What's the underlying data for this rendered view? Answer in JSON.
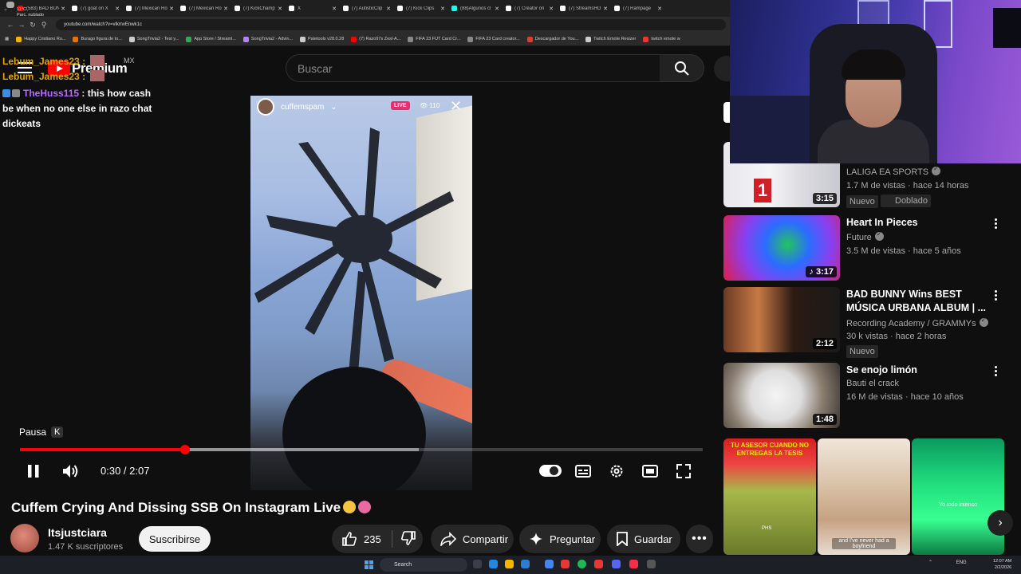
{
  "browser": {
    "tabs": [
      {
        "label": "(583) BAD BUNNY",
        "color": "#ff0000"
      },
      {
        "label": "(7) goat on X",
        "color": "#ffffff"
      },
      {
        "label": "(7) Mexican Ro",
        "color": "#ffffff"
      },
      {
        "label": "(7) Mexican Ro",
        "color": "#ffffff"
      },
      {
        "label": "(7) KickChamp",
        "color": "#ffffff"
      },
      {
        "label": "X",
        "color": "#ffffff"
      },
      {
        "label": "(7) AutisticClip",
        "color": "#ffffff"
      },
      {
        "label": "(7) Kick Clips",
        "color": "#ffffff"
      },
      {
        "label": "(88)Algunos cl",
        "color": "#25f4ee"
      },
      {
        "label": "(7) Creator on",
        "color": "#ffffff"
      },
      {
        "label": "(7) StreamsHO",
        "color": "#ffffff"
      },
      {
        "label": "(7) Rampage",
        "color": "#ffffff"
      }
    ],
    "url": "youtube.com/watch?v=vlkmvEnwk1c",
    "bookmarks": [
      {
        "label": "Happy Cristiano Ro...",
        "color": "#f4b400"
      },
      {
        "label": "Burago figura de to...",
        "color": "#e8710a"
      },
      {
        "label": "SongTrivia2 - Test y...",
        "color": "#cccccc"
      },
      {
        "label": "App Store / Streaml...",
        "color": "#34a853"
      },
      {
        "label": "SongTrivia2 - Advin...",
        "color": "#b084f5"
      },
      {
        "label": "Paletools v28.0.28",
        "color": "#cccccc"
      },
      {
        "label": "(7) Razo97s Zesl-A...",
        "color": "#ff0000"
      },
      {
        "label": "FIFA 23 FUT Card Cr...",
        "color": "#888888"
      },
      {
        "label": "FIFA 23 Card creator...",
        "color": "#888888"
      },
      {
        "label": "Descargador de You...",
        "color": "#e53935"
      },
      {
        "label": "Twitch Emote Resizer",
        "color": "#cccccc"
      },
      {
        "label": "twitch emote w",
        "color": "#e53935"
      }
    ]
  },
  "header": {
    "logo_text": "Premium",
    "logo_cc": "MX",
    "search_placeholder": "Buscar"
  },
  "chat": [
    {
      "user": "Lebum_James23",
      "sep": " :",
      "text": ""
    },
    {
      "user": "Lebum_James23",
      "sep": " :",
      "text": ""
    },
    {
      "user": "TheHuss115",
      "sep": " : ",
      "text": "this how cash be when no one else in razo chat dickeats"
    }
  ],
  "player": {
    "instagram_user": "cuffemspam",
    "live_label": "LIVE",
    "viewers": "110",
    "tooltip": "Pausa",
    "tooltip_key": "K",
    "time_display": "0:30 / 2:07",
    "progress_fraction": 0.242,
    "buffer_fraction": 0.584
  },
  "video": {
    "title": "Cuffem Crying And Dissing SSB On Instagram Live",
    "channel": "Itsjustciara",
    "subscribers": "1.47 K suscriptores",
    "subscribe_label": "Suscribirse",
    "likes": "235",
    "share_label": "Compartir",
    "ask_label": "Preguntar",
    "save_label": "Guardar"
  },
  "recommendations": [
    {
      "title": "",
      "channel": "LALIGA EA SPORTS",
      "meta": "1.7 M de vistas · hace 14 horas",
      "duration": "3:15",
      "tags": [
        "Nuevo",
        "Doblado"
      ]
    },
    {
      "title": "Heart In Pieces",
      "channel": "Future",
      "meta": "3.5 M de vistas · hace 5 años",
      "duration": "3:17",
      "tags": []
    },
    {
      "title": "BAD BUNNY Wins BEST MÚSICA URBANA ALBUM | ...",
      "channel": "Recording Academy / GRAMMYs",
      "meta": "30 k vistas · hace 2 horas",
      "duration": "2:12",
      "tags": [
        "Nuevo"
      ]
    },
    {
      "title": "Se enojo limón",
      "channel": "Bauti el crack",
      "meta": "16 M de vistas · hace 10 años",
      "duration": "1:48",
      "tags": []
    }
  ],
  "shorts": [
    {
      "caption": "TU ASESOR CUANDO NO ENTREGAS LA TESIS",
      "overlay": "PHS"
    },
    {
      "caption": "",
      "overlay": "and I've never had a boyfriend"
    },
    {
      "caption": "",
      "overlay": "Yo todo intenso"
    }
  ],
  "taskbar": {
    "temp": "11°C",
    "weather": "Parc. nublado",
    "search": "Search",
    "lang": "ENG",
    "time": "12:07 AM",
    "date": "2/2/2026"
  }
}
